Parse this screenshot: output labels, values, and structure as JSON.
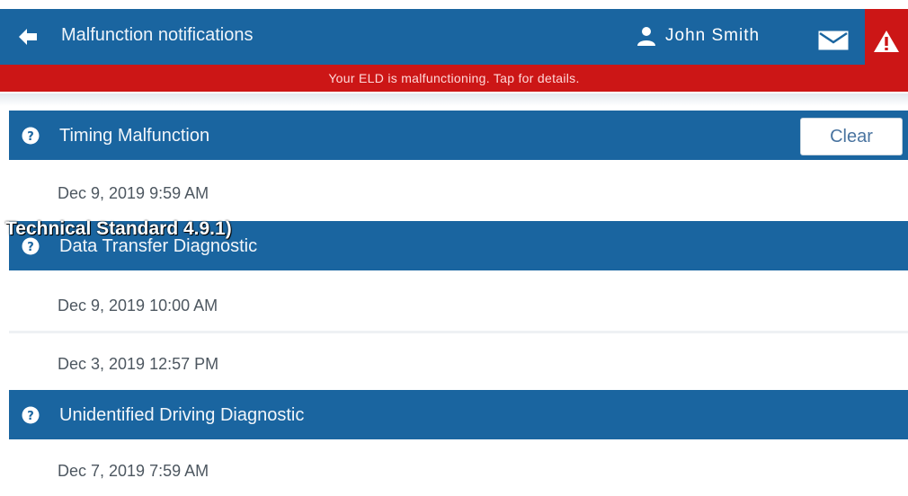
{
  "header": {
    "title": "Malfunction notifications",
    "user_name": "John Smith",
    "alert_text": "Your ELD is malfunctioning. Tap for details."
  },
  "sections": [
    {
      "label": "Timing Malfunction",
      "clear_label": "Clear",
      "entries": [
        "Dec 9, 2019 9:59 AM"
      ]
    },
    {
      "label": "Data Transfer Diagnostic",
      "entries": [
        "Dec 9, 2019 10:00 AM",
        "Dec 3, 2019 12:57 PM"
      ]
    },
    {
      "label": "Unidentified Driving Diagnostic",
      "entries": [
        "Dec 7, 2019 7:59 AM"
      ]
    }
  ],
  "overlay_text": "Technical Standard 4.9.1)",
  "colors": {
    "header_blue": "#1a65a0",
    "alert_red": "#cc1616"
  },
  "icons": [
    "back-arrow-icon",
    "user-icon",
    "mail-icon",
    "warning-icon",
    "question-circle-icon"
  ]
}
